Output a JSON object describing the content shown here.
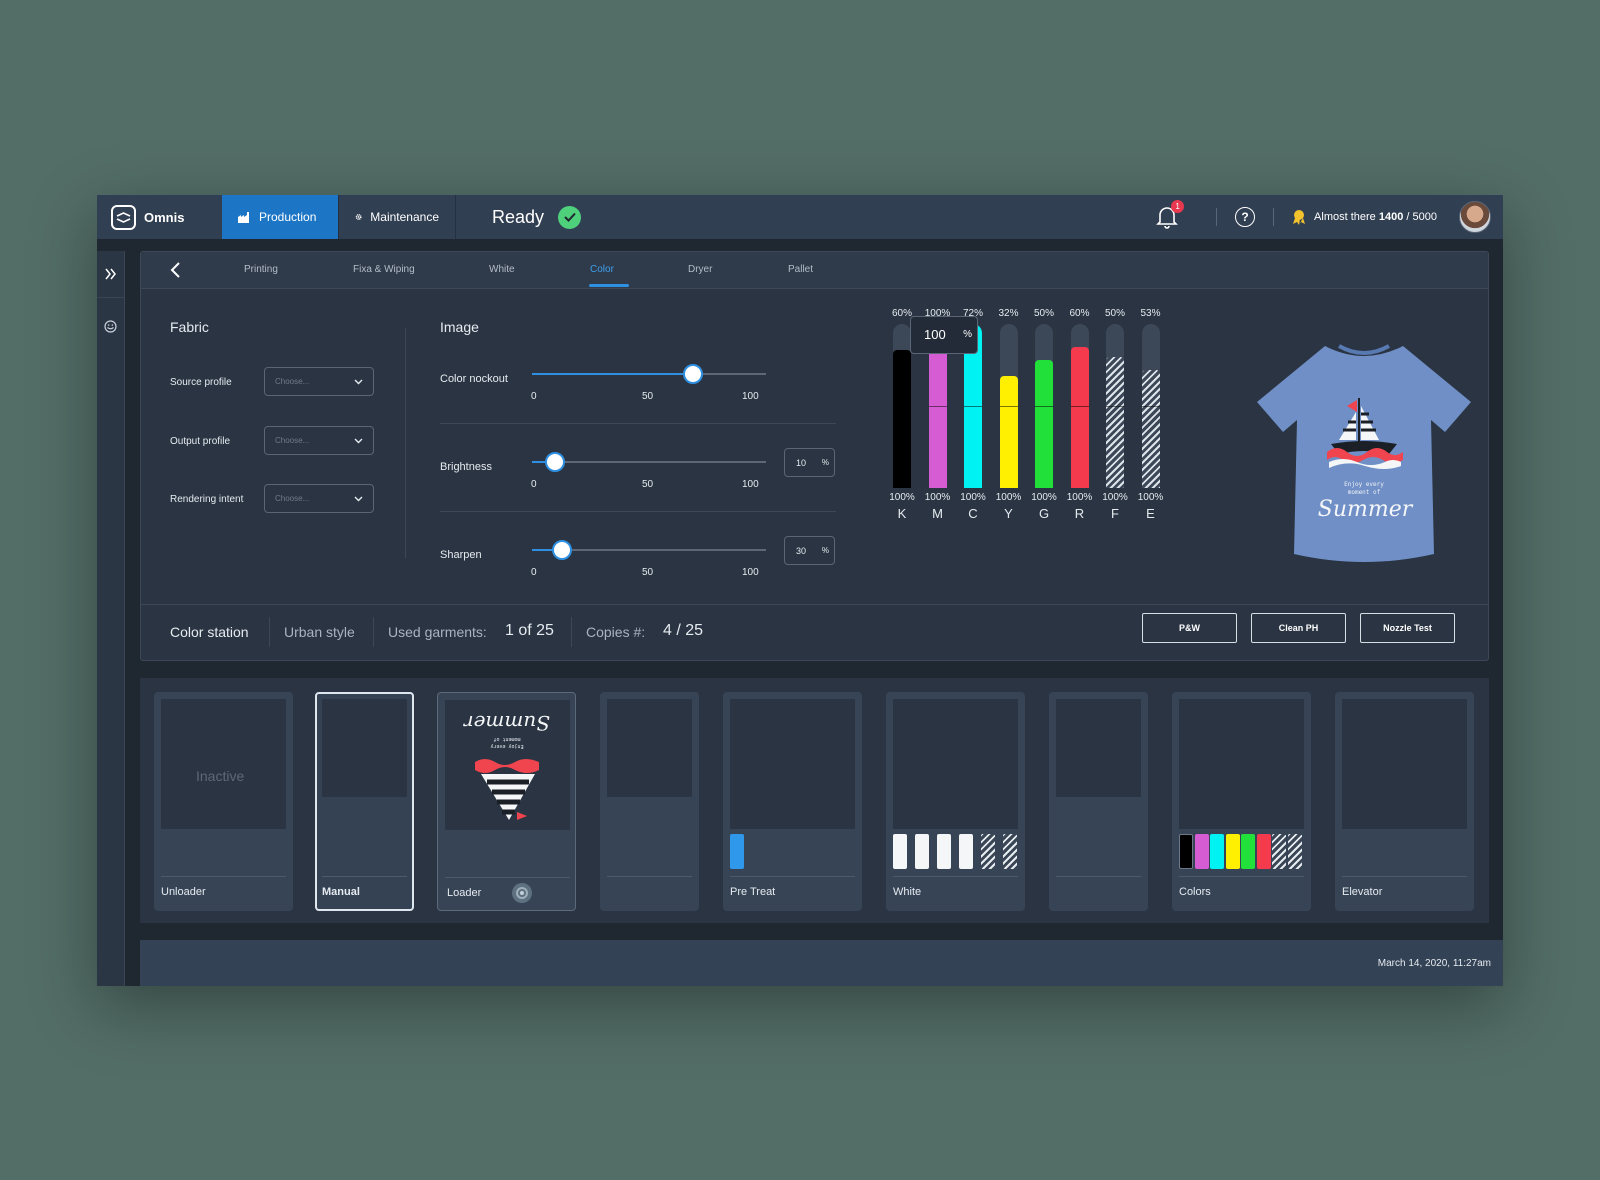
{
  "brand": {
    "name": "Omnis"
  },
  "nav": {
    "production": "Production",
    "maintenance": "Maintenance"
  },
  "status": {
    "label": "Ready"
  },
  "notifications": {
    "count": "1"
  },
  "progress": {
    "prefix": "Almost there ",
    "current": "1400",
    "separator": " / ",
    "goal": "5000"
  },
  "tabs": [
    "Printing",
    "Fixa & Wiping",
    "White",
    "Color",
    "Dryer",
    "Pallet"
  ],
  "active_tab": "Color",
  "fabric": {
    "title": "Fabric",
    "fields": [
      {
        "label": "Source profile",
        "placeholder": "Choose..."
      },
      {
        "label": "Output profile",
        "placeholder": "Choose..."
      },
      {
        "label": "Rendering intent",
        "placeholder": "Choose..."
      }
    ]
  },
  "image": {
    "title": "Image",
    "sliders": [
      {
        "label": "Color nockout",
        "value": 69,
        "ticks": [
          "0",
          "50",
          "100"
        ],
        "box": ""
      },
      {
        "label": "Brightness",
        "value": 10,
        "ticks": [
          "0",
          "50",
          "100"
        ],
        "box": "10"
      },
      {
        "label": "Sharpen",
        "value": 13,
        "ticks": [
          "0",
          "50",
          "100"
        ],
        "box": "30"
      }
    ],
    "percent": "%"
  },
  "inks": {
    "tooltip_value": "100",
    "tooltip_unit": "%",
    "items": [
      {
        "letter": "K",
        "level": "60%",
        "capacity": "100%",
        "fill": 0.84,
        "color": "#000000",
        "hatch": false
      },
      {
        "letter": "M",
        "level": "100%",
        "capacity": "100%",
        "fill": 1.0,
        "color": "#d65cd3",
        "hatch": false
      },
      {
        "letter": "C",
        "level": "72%",
        "capacity": "100%",
        "fill": 1.0,
        "color": "#00f2f2",
        "hatch": false
      },
      {
        "letter": "Y",
        "level": "32%",
        "capacity": "100%",
        "fill": 0.68,
        "color": "#ffef00",
        "hatch": false
      },
      {
        "letter": "G",
        "level": "50%",
        "capacity": "100%",
        "fill": 0.78,
        "color": "#22e03a",
        "hatch": false
      },
      {
        "letter": "R",
        "level": "60%",
        "capacity": "100%",
        "fill": 0.86,
        "color": "#f53a4e",
        "hatch": false
      },
      {
        "letter": "F",
        "level": "50%",
        "capacity": "100%",
        "fill": 0.8,
        "color": "#dde3ea",
        "hatch": true
      },
      {
        "letter": "E",
        "level": "53%",
        "capacity": "100%",
        "fill": 0.72,
        "color": "#dde3ea",
        "hatch": true
      }
    ]
  },
  "preview": {
    "line1": "Enjoy every",
    "line2": "moment of",
    "script": "Summer",
    "shirt_color": "#6f8fc6"
  },
  "footer": {
    "station": "Color station",
    "style": "Urban style",
    "used_label": "Used garments:",
    "used_value": "1 of 25",
    "copies_label": "Copies #:",
    "copies_value": "4 / 25",
    "buttons": [
      "P&W",
      "Clean PH",
      "Nozzle Test"
    ]
  },
  "stations": {
    "inactive_label": "Inactive",
    "items": [
      "Unloader",
      "Manual",
      "Loader",
      "",
      "Pre Treat",
      "White",
      "",
      "Colors",
      "Elevator"
    ]
  },
  "statusbar": {
    "date": "March 14, 2020,  11:27am"
  }
}
